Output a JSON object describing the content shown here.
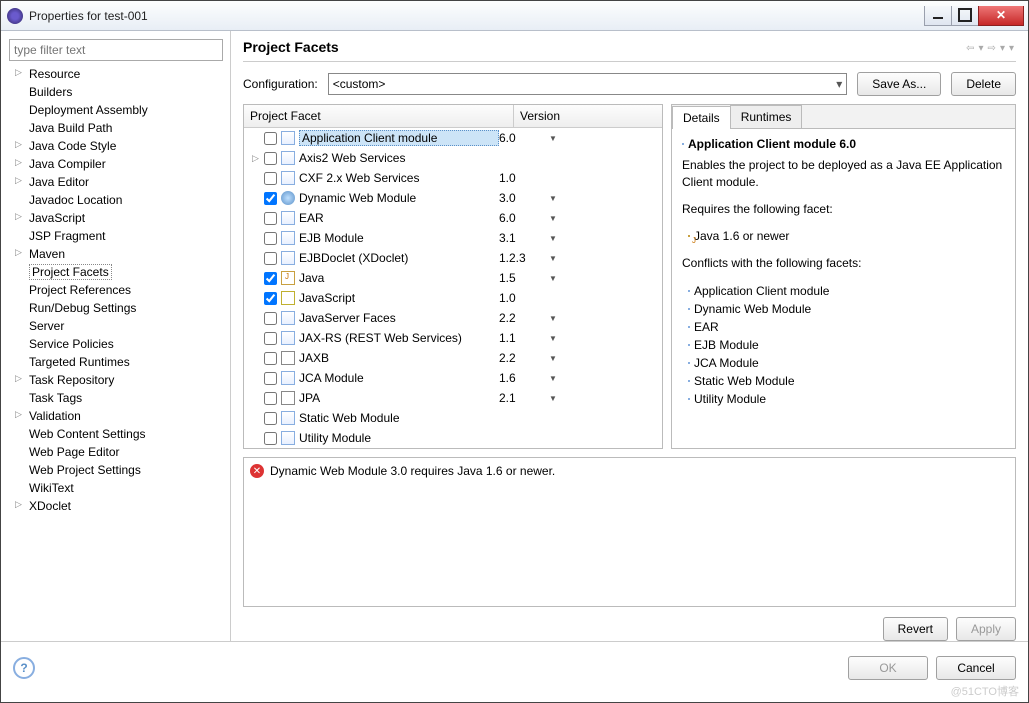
{
  "window": {
    "title": "Properties for test-001"
  },
  "sidebar": {
    "filter_placeholder": "type filter text",
    "items": [
      {
        "label": "Resource",
        "expandable": true
      },
      {
        "label": "Builders"
      },
      {
        "label": "Deployment Assembly"
      },
      {
        "label": "Java Build Path"
      },
      {
        "label": "Java Code Style",
        "expandable": true
      },
      {
        "label": "Java Compiler",
        "expandable": true
      },
      {
        "label": "Java Editor",
        "expandable": true
      },
      {
        "label": "Javadoc Location"
      },
      {
        "label": "JavaScript",
        "expandable": true
      },
      {
        "label": "JSP Fragment"
      },
      {
        "label": "Maven",
        "expandable": true
      },
      {
        "label": "Project Facets",
        "selected": true
      },
      {
        "label": "Project References"
      },
      {
        "label": "Run/Debug Settings"
      },
      {
        "label": "Server"
      },
      {
        "label": "Service Policies"
      },
      {
        "label": "Targeted Runtimes"
      },
      {
        "label": "Task Repository",
        "expandable": true
      },
      {
        "label": "Task Tags"
      },
      {
        "label": "Validation",
        "expandable": true
      },
      {
        "label": "Web Content Settings"
      },
      {
        "label": "Web Page Editor"
      },
      {
        "label": "Web Project Settings"
      },
      {
        "label": "WikiText"
      },
      {
        "label": "XDoclet",
        "expandable": true
      }
    ]
  },
  "main": {
    "heading": "Project Facets",
    "config_label": "Configuration:",
    "config_value": "<custom>",
    "save_as_label": "Save As...",
    "delete_label": "Delete",
    "revert_label": "Revert",
    "apply_label": "Apply"
  },
  "facet_table": {
    "col1": "Project Facet",
    "col2": "Version",
    "rows": [
      {
        "expandable": false,
        "checked": false,
        "icon": "file",
        "name": "Application Client module",
        "ver": "6.0",
        "drop": true,
        "selected": true
      },
      {
        "expandable": true,
        "checked": false,
        "icon": "file",
        "name": "Axis2 Web Services",
        "ver": "",
        "drop": false
      },
      {
        "expandable": false,
        "checked": false,
        "icon": "file",
        "name": "CXF 2.x Web Services",
        "ver": "1.0",
        "drop": false
      },
      {
        "expandable": false,
        "checked": true,
        "icon": "globe",
        "name": "Dynamic Web Module",
        "ver": "3.0",
        "drop": true
      },
      {
        "expandable": false,
        "checked": false,
        "icon": "file",
        "name": "EAR",
        "ver": "6.0",
        "drop": true
      },
      {
        "expandable": false,
        "checked": false,
        "icon": "file",
        "name": "EJB Module",
        "ver": "3.1",
        "drop": true
      },
      {
        "expandable": false,
        "checked": false,
        "icon": "file",
        "name": "EJBDoclet (XDoclet)",
        "ver": "1.2.3",
        "drop": true
      },
      {
        "expandable": false,
        "checked": true,
        "icon": "java",
        "name": "Java",
        "ver": "1.5",
        "drop": true
      },
      {
        "expandable": false,
        "checked": true,
        "icon": "js",
        "name": "JavaScript",
        "ver": "1.0",
        "drop": false
      },
      {
        "expandable": false,
        "checked": false,
        "icon": "file",
        "name": "JavaServer Faces",
        "ver": "2.2",
        "drop": true
      },
      {
        "expandable": false,
        "checked": false,
        "icon": "file",
        "name": "JAX-RS (REST Web Services)",
        "ver": "1.1",
        "drop": true
      },
      {
        "expandable": false,
        "checked": false,
        "icon": "jpa",
        "name": "JAXB",
        "ver": "2.2",
        "drop": true
      },
      {
        "expandable": false,
        "checked": false,
        "icon": "file",
        "name": "JCA Module",
        "ver": "1.6",
        "drop": true
      },
      {
        "expandable": false,
        "checked": false,
        "icon": "jpa",
        "name": "JPA",
        "ver": "2.1",
        "drop": true
      },
      {
        "expandable": false,
        "checked": false,
        "icon": "file",
        "name": "Static Web Module",
        "ver": "",
        "drop": false
      },
      {
        "expandable": false,
        "checked": false,
        "icon": "file",
        "name": "Utility Module",
        "ver": "",
        "drop": false
      }
    ]
  },
  "details": {
    "tab_details": "Details",
    "tab_runtimes": "Runtimes",
    "title": "Application Client module 6.0",
    "description": "Enables the project to be deployed as a Java EE Application Client module.",
    "requires_label": "Requires the following facet:",
    "requires": [
      "Java 1.6 or newer"
    ],
    "conflicts_label": "Conflicts with the following facets:",
    "conflicts": [
      "Application Client module",
      "Dynamic Web Module",
      "EAR",
      "EJB Module",
      "JCA Module",
      "Static Web Module",
      "Utility Module"
    ]
  },
  "error": {
    "message": "Dynamic Web Module 3.0 requires Java 1.6 or newer."
  },
  "dialog": {
    "ok": "OK",
    "cancel": "Cancel"
  },
  "watermark": "@51CTO博客"
}
